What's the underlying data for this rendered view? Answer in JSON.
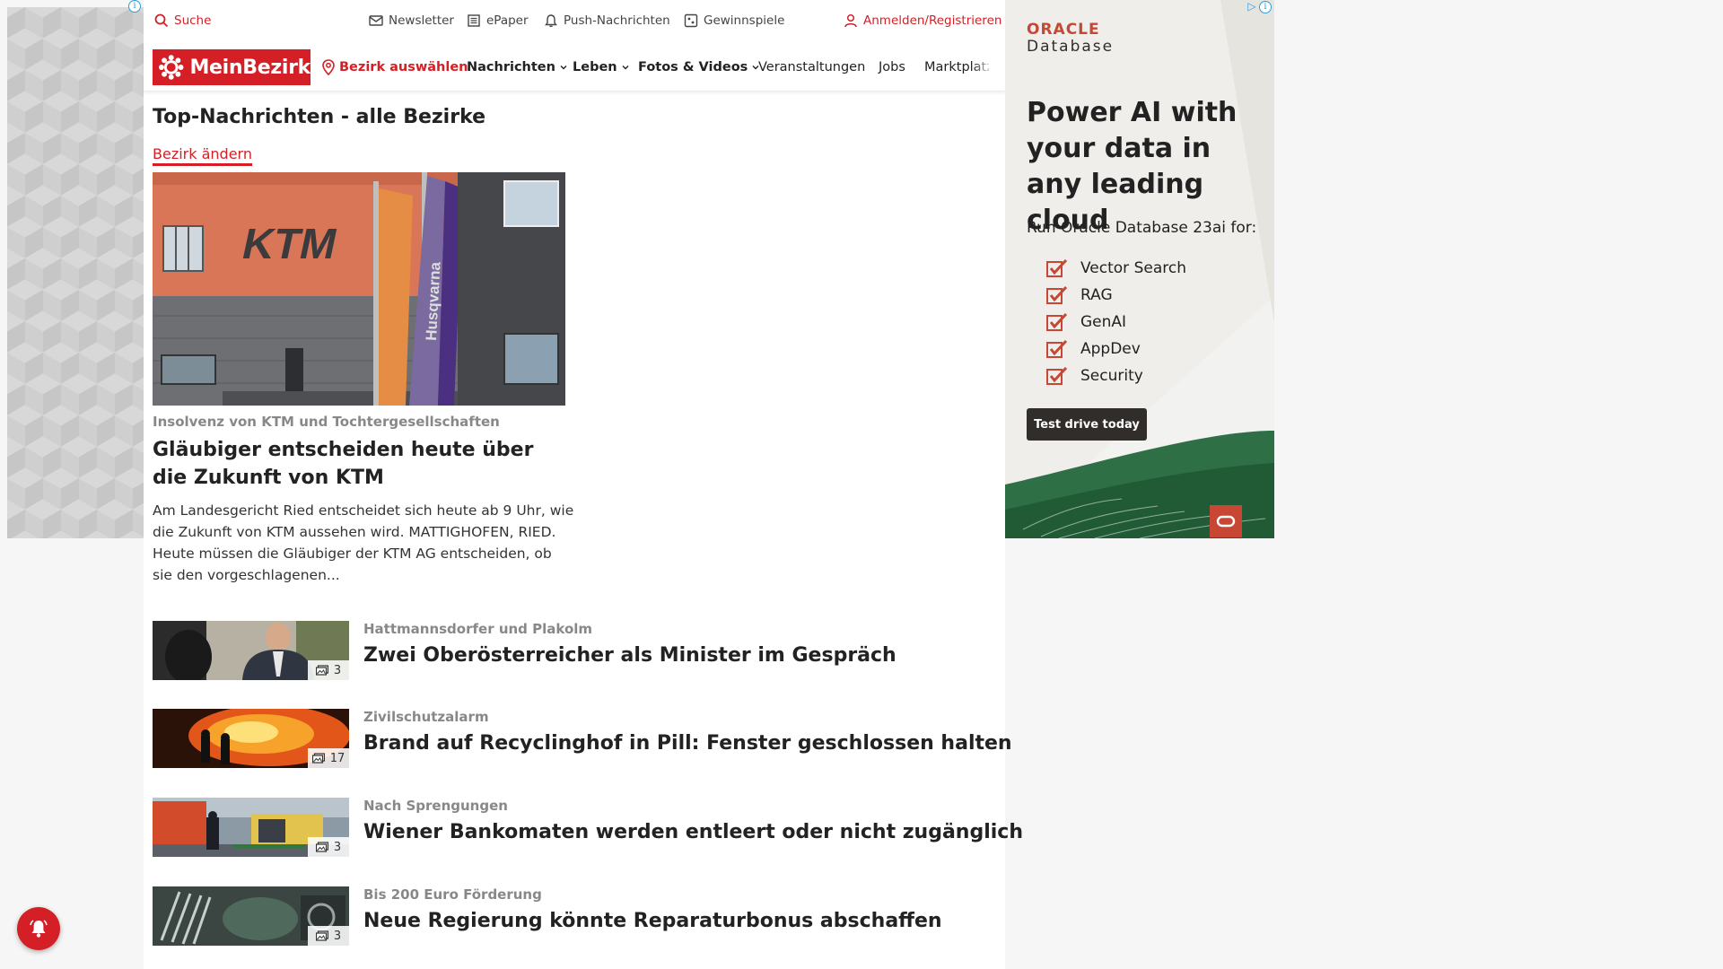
{
  "utility_bar": {
    "search_label": "Suche",
    "links": [
      "Newsletter",
      "ePaper",
      "Push-Nachrichten",
      "Gewinnspiele"
    ],
    "login_label": "Anmelden/Registrieren"
  },
  "brand": {
    "logo_text": "MeinBezirk",
    "color": "#d51f26"
  },
  "nav": {
    "district_select": "Bezirk auswählen",
    "items": [
      "Nachrichten",
      "Leben",
      "Fotos & Videos",
      "Veranstaltungen",
      "Jobs",
      "Marktplatz"
    ]
  },
  "page": {
    "title": "Top-Nachrichten - alle Bezirke",
    "change_district": "Bezirk ändern"
  },
  "featured": {
    "kicker": "Insolvenz von KTM und Tochtergesellschaften",
    "title": "Gläubiger entscheiden heute über die Zukunft von KTM",
    "teaser": "Am Landesgericht Ried entscheidet sich heute ab 9 Uhr, wie die Zukunft von KTM aussehen wird. MATTIGHOFEN, RIED. Heute müssen die Gläubiger der KTM AG entscheiden, ob sie den vorgeschlagenen...",
    "image_sign_text": "KTM",
    "image_flag_text": "Husqvarna"
  },
  "articles": [
    {
      "kicker": "Hattmannsdorfer und Plakolm",
      "title": "Zwei Oberösterreicher als Minister im Gespräch",
      "photo_count": "3"
    },
    {
      "kicker": "Zivilschutzalarm",
      "title": "Brand auf Recyclinghof in Pill: Fenster geschlossen halten",
      "photo_count": "17"
    },
    {
      "kicker": "Nach Sprengungen",
      "title": "Wiener Bankomaten werden entleert oder nicht zugänglich",
      "photo_count": "3"
    },
    {
      "kicker": "Bis 200 Euro Förderung",
      "title": "Neue Regierung könnte Reparaturbonus abschaffen",
      "photo_count": "3"
    }
  ],
  "ad": {
    "brand_name": "ORACLE",
    "brand_product": "Database",
    "headline": "Power AI with your data in any leading cloud",
    "subhead": "Run Oracle Database 23ai for:",
    "features": [
      "Vector Search",
      "RAG",
      "GenAI",
      "AppDev",
      "Security"
    ],
    "cta": "Test drive today",
    "accent": "#c74634",
    "check_color": "#c74634"
  },
  "icons": {
    "search": "search-icon",
    "newsletter": "mail-icon",
    "epaper": "newspaper-icon",
    "push": "bell-icon",
    "raffle": "ticket-icon",
    "login": "user-icon",
    "location": "map-pin-icon",
    "chevron": "chevron-down-icon",
    "gallery": "image-icon",
    "ad_choices": "adchoices-icon",
    "info": "info-icon",
    "notify": "notification-bell-icon"
  }
}
